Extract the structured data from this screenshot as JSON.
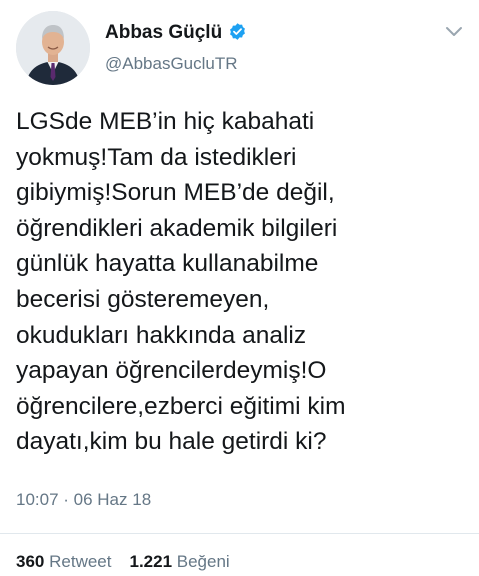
{
  "author": {
    "display_name": "Abbas Güçlü",
    "handle": "@AbbasGucluTR",
    "verified_icon": "verified-badge-icon",
    "avatar_icon": "profile-photo"
  },
  "menu": {
    "icon": "chevron-down-icon"
  },
  "tweet": {
    "lines": [
      "LGSde MEB’in hiç kabahati",
      "yokmuş!Tam da istedikleri",
      "gibiymiş!Sorun MEB’de değil,",
      "öğrendikleri akademik bilgileri",
      "günlük hayatta kullanabilme",
      "becerisi gösteremeyen,",
      "okudukları hakkında analiz",
      "yapayan öğrencilerdeymiş!O",
      "öğrencilere,ezberci eğitimi kim",
      "dayatı,kim bu hale getirdi ki?"
    ],
    "timestamp": "10:07 · 06 Haz 18"
  },
  "stats": {
    "retweet_count": "360",
    "retweet_label": "Retweet",
    "like_count": "1.221",
    "like_label": "Beğeni"
  },
  "colors": {
    "text": "#14171a",
    "secondary": "#657786",
    "verified": "#1da1f2",
    "divider": "#e1e8ed"
  }
}
